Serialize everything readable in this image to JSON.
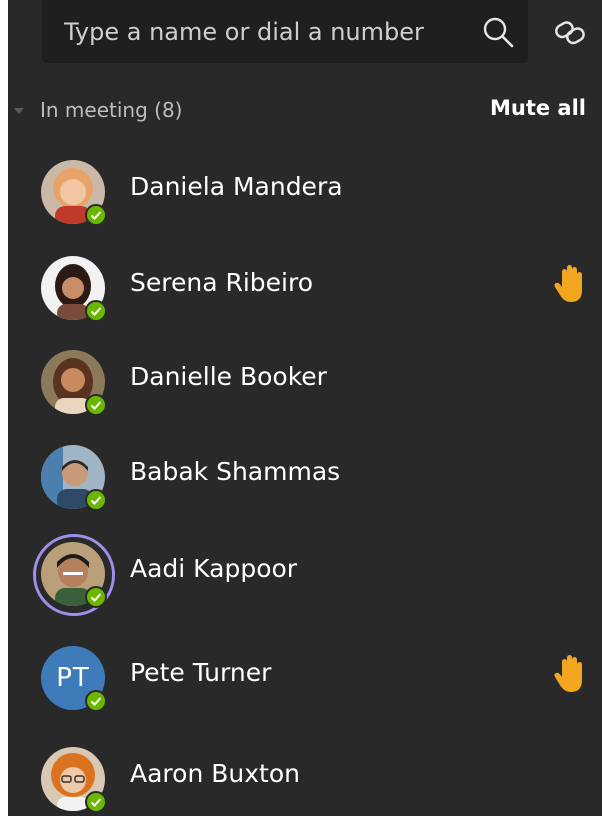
{
  "search": {
    "placeholder": "Type a name or dial a number",
    "search_icon": "search-icon",
    "link_icon": "link-icon"
  },
  "section": {
    "label": "In meeting (8)",
    "mute_all_label": "Mute all"
  },
  "colors": {
    "panel_bg": "#292929",
    "available": "#6bb700",
    "hand": "#f3a620",
    "pt_avatar": "#3d7cb8",
    "speaking_ring": "#a08ee8"
  },
  "participants": [
    {
      "name": "Daniela Mandera",
      "status": "available",
      "hand_raised": false,
      "avatar": "photo"
    },
    {
      "name": "Serena Ribeiro",
      "status": "available",
      "hand_raised": true,
      "avatar": "photo"
    },
    {
      "name": "Danielle Booker",
      "status": "available",
      "hand_raised": false,
      "avatar": "photo"
    },
    {
      "name": "Babak Shammas",
      "status": "available",
      "hand_raised": false,
      "avatar": "photo"
    },
    {
      "name": "Aadi Kappoor",
      "status": "available",
      "hand_raised": false,
      "avatar": "photo",
      "speaking": true
    },
    {
      "name": "Pete Turner",
      "status": "available",
      "hand_raised": true,
      "avatar": "initials",
      "initials": "PT"
    },
    {
      "name": "Aaron Buxton",
      "status": "available",
      "hand_raised": false,
      "avatar": "photo"
    }
  ]
}
